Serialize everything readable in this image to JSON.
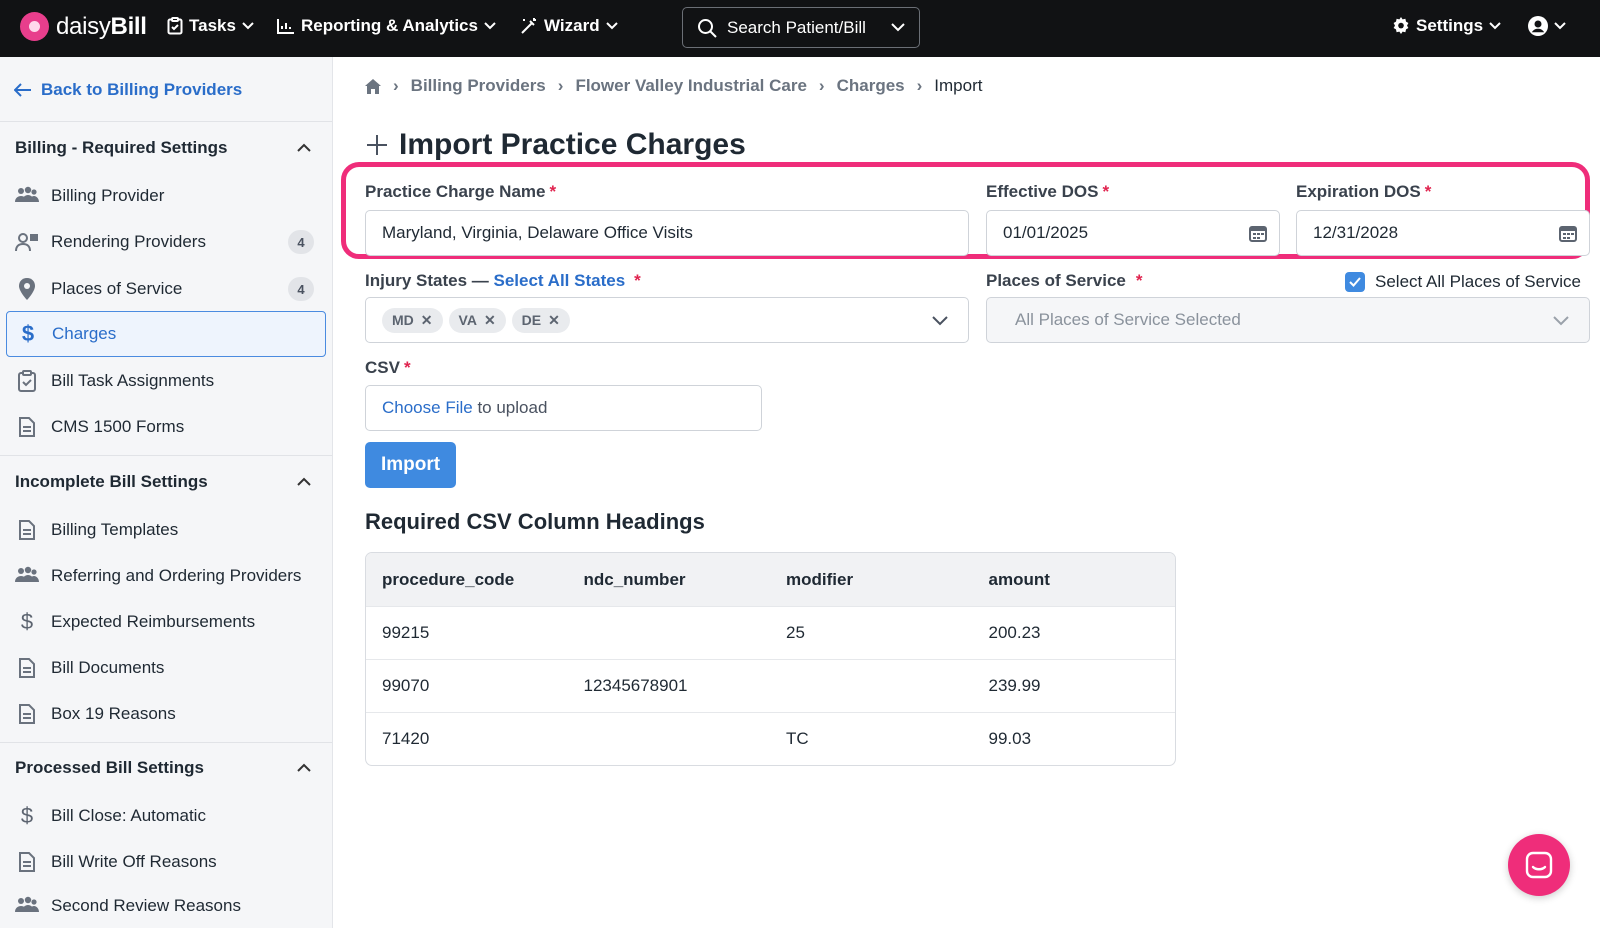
{
  "brand": {
    "name_light": "daisy",
    "name_bold": "Bill"
  },
  "nav": {
    "tasks": "Tasks",
    "reporting": "Reporting & Analytics",
    "wizard": "Wizard",
    "search": "Search Patient/Bill",
    "settings": "Settings"
  },
  "sidebar": {
    "back": "Back to Billing Providers",
    "sections": [
      {
        "title": "Billing - Required Settings",
        "items": [
          {
            "label": "Billing Provider",
            "icon": "people-icon"
          },
          {
            "label": "Rendering Providers",
            "icon": "doctor-icon",
            "count": "4"
          },
          {
            "label": "Places of Service",
            "icon": "map-pin-icon",
            "count": "4"
          },
          {
            "label": "Charges",
            "icon": "dollar-icon",
            "active": true
          },
          {
            "label": "Bill Task Assignments",
            "icon": "clipboard-icon"
          },
          {
            "label": "CMS 1500 Forms",
            "icon": "document-icon"
          }
        ]
      },
      {
        "title": "Incomplete Bill Settings",
        "items": [
          {
            "label": "Billing Templates",
            "icon": "document-icon"
          },
          {
            "label": "Referring and Ordering Providers",
            "icon": "people-icon"
          },
          {
            "label": "Expected Reimbursements",
            "icon": "dollar-icon"
          },
          {
            "label": "Bill Documents",
            "icon": "document-icon"
          },
          {
            "label": "Box 19 Reasons",
            "icon": "document-icon"
          }
        ]
      },
      {
        "title": "Processed Bill Settings",
        "items": [
          {
            "label": "Bill Close: Automatic",
            "icon": "dollar-icon"
          },
          {
            "label": "Bill Write Off Reasons",
            "icon": "document-icon"
          },
          {
            "label": "Second Review Reasons",
            "icon": "people-icon"
          }
        ]
      }
    ]
  },
  "breadcrumb": [
    "Billing Providers",
    "Flower Valley Industrial Care",
    "Charges",
    "Import"
  ],
  "page": {
    "title": "Import Practice Charges",
    "charge_name_label": "Practice Charge Name",
    "charge_name_value": "Maryland, Virginia, Delaware Office Visits",
    "effective_label": "Effective DOS",
    "effective_value": "01/01/2025",
    "expiration_label": "Expiration DOS",
    "expiration_value": "12/31/2028",
    "injury_label": "Injury States —",
    "select_all_states": "Select All States",
    "states": [
      "MD",
      "VA",
      "DE"
    ],
    "pos_label": "Places of Service",
    "select_all_pos": "Select All Places of Service",
    "pos_value": "All Places of Service Selected",
    "csv_label": "CSV",
    "choose_file": "Choose File",
    "to_upload": "to upload",
    "import_btn": "Import",
    "required_heading": "Required CSV Column Headings"
  },
  "table": {
    "headers": [
      "procedure_code",
      "ndc_number",
      "modifier",
      "amount"
    ],
    "rows": [
      [
        "99215",
        "",
        "25",
        "200.23"
      ],
      [
        "99070",
        "12345678901",
        "",
        "239.99"
      ],
      [
        "71420",
        "",
        "TC",
        "99.03"
      ]
    ]
  },
  "colors": {
    "accent": "#2a6dc9",
    "highlight": "#ef2d7a",
    "topbar": "#111214"
  }
}
